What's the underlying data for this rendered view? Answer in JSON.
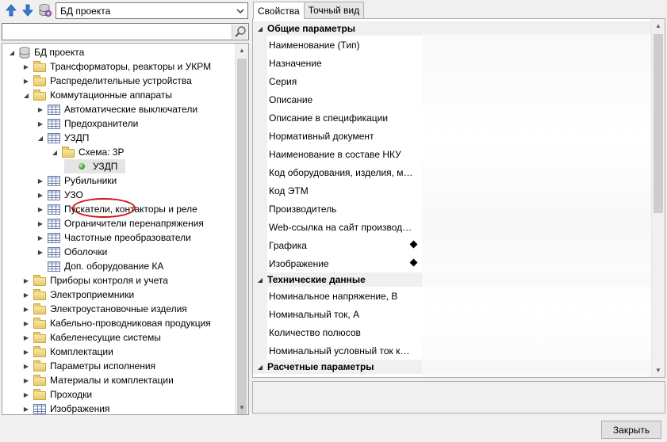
{
  "toolbar": {
    "db_select_value": "БД проекта",
    "icons": [
      "arrow-up-icon",
      "arrow-down-icon",
      "database-settings-icon",
      "search-icon",
      "chevron-down-icon"
    ]
  },
  "search": {
    "placeholder": ""
  },
  "tree": {
    "items": [
      {
        "label": "БД проекта",
        "icon": "database-icon",
        "expander": "expanded"
      },
      {
        "label": "Трансформаторы, реакторы и УКРМ",
        "icon": "folder-icon",
        "expander": "collapsed"
      },
      {
        "label": "Распределительные устройства",
        "icon": "folder-icon",
        "expander": "collapsed"
      },
      {
        "label": "Коммутационные аппараты",
        "icon": "folder-icon",
        "expander": "expanded"
      },
      {
        "label": "Автоматические выключатели",
        "icon": "table-icon",
        "expander": "collapsed"
      },
      {
        "label": "Предохранители",
        "icon": "table-icon",
        "expander": "collapsed"
      },
      {
        "label": "УЗДП",
        "icon": "table-icon",
        "expander": "expanded"
      },
      {
        "label": "Схема: 3P",
        "icon": "folder-open-icon",
        "expander": "expanded"
      },
      {
        "label": "УЗДП",
        "icon": "green-dot-icon",
        "expander": "none",
        "selected": true,
        "highlighted": true
      },
      {
        "label": "Рубильники",
        "icon": "table-icon",
        "expander": "collapsed"
      },
      {
        "label": "УЗО",
        "icon": "table-icon",
        "expander": "collapsed"
      },
      {
        "label": "Пускатели, контакторы и реле",
        "icon": "table-icon",
        "expander": "collapsed"
      },
      {
        "label": "Ограничители перенапряжения",
        "icon": "table-icon",
        "expander": "collapsed"
      },
      {
        "label": "Частотные преобразователи",
        "icon": "table-icon",
        "expander": "collapsed"
      },
      {
        "label": "Оболочки",
        "icon": "table-icon",
        "expander": "collapsed"
      },
      {
        "label": "Доп. оборудование КА",
        "icon": "table-icon",
        "expander": "none"
      },
      {
        "label": "Приборы контроля и учета",
        "icon": "folder-icon",
        "expander": "collapsed"
      },
      {
        "label": "Электроприемники",
        "icon": "folder-icon",
        "expander": "collapsed"
      },
      {
        "label": "Электроустановочные изделия",
        "icon": "folder-icon",
        "expander": "collapsed"
      },
      {
        "label": "Кабельно-проводниковая продукция",
        "icon": "folder-icon",
        "expander": "collapsed"
      },
      {
        "label": "Кабеленесущие системы",
        "icon": "folder-icon",
        "expander": "collapsed"
      },
      {
        "label": "Комплектации",
        "icon": "folder-icon",
        "expander": "collapsed"
      },
      {
        "label": "Параметры исполнения",
        "icon": "folder-icon",
        "expander": "collapsed"
      },
      {
        "label": "Материалы и комплектации",
        "icon": "folder-icon",
        "expander": "collapsed"
      },
      {
        "label": "Проходки",
        "icon": "folder-icon",
        "expander": "collapsed"
      },
      {
        "label": "Изображения",
        "icon": "table-icon",
        "expander": "collapsed"
      }
    ]
  },
  "tabs": [
    {
      "label": "Свойства",
      "active": true
    },
    {
      "label": "Точный вид",
      "active": false
    }
  ],
  "properties": {
    "categories": [
      {
        "title": "Общие параметры",
        "rows": [
          {
            "name": "Наименование (Тип)"
          },
          {
            "name": "Назначение"
          },
          {
            "name": "Серия"
          },
          {
            "name": "Описание"
          },
          {
            "name": "Описание в спецификации"
          },
          {
            "name": "Нормативный документ"
          },
          {
            "name": "Наименование в составе НКУ"
          },
          {
            "name": "Код оборудования, изделия, материала"
          },
          {
            "name": "Код ЭТМ"
          },
          {
            "name": "Производитель"
          },
          {
            "name": "Web-ссылка на сайт производителя"
          },
          {
            "name": "Графика",
            "marker": "diamond"
          },
          {
            "name": "Изображение",
            "marker": "diamond"
          }
        ]
      },
      {
        "title": "Технические данные",
        "rows": [
          {
            "name": "Номинальное напряжение, В"
          },
          {
            "name": "Номинальный ток, А"
          },
          {
            "name": "Количество полюсов"
          },
          {
            "name": "Номинальный условный ток короткого замыкания"
          }
        ]
      },
      {
        "title": "Расчетные параметры",
        "rows": []
      }
    ]
  },
  "footer": {
    "close_label": "Закрыть"
  }
}
